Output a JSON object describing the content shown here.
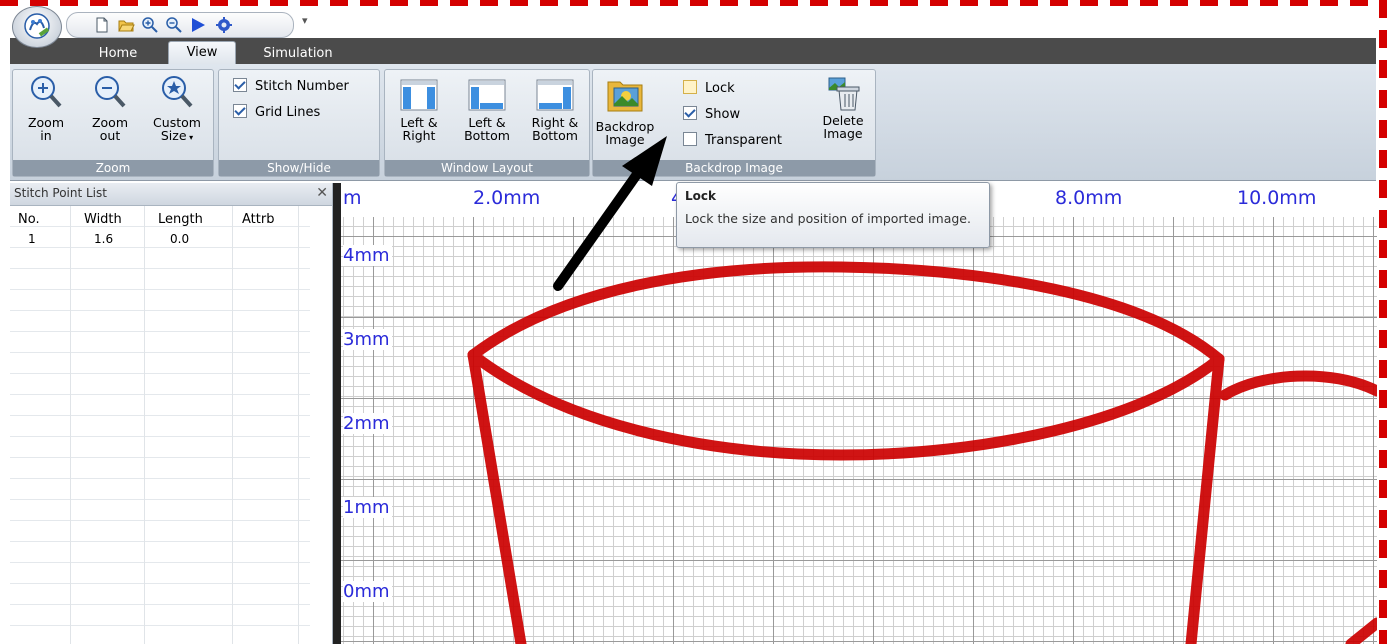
{
  "tabs": [
    "Home",
    "View",
    "Simulation"
  ],
  "active_tab": "View",
  "ribbon": {
    "zoom_group": {
      "label": "Zoom",
      "zoom_in": "Zoom\nin",
      "zoom_in_l1": "Zoom",
      "zoom_in_l2": "in",
      "zoom_out_l1": "Zoom",
      "zoom_out_l2": "out",
      "custom_l1": "Custom",
      "custom_l2": "Size"
    },
    "showhide_group": {
      "label": "Show/Hide",
      "stitch_number": "Stitch Number",
      "stitch_number_checked": true,
      "grid_lines": "Grid Lines",
      "grid_lines_checked": true
    },
    "layout_group": {
      "label": "Window Layout",
      "left_right_l1": "Left &",
      "left_right_l2": "Right",
      "left_bottom_l1": "Left &",
      "left_bottom_l2": "Bottom",
      "right_bottom_l1": "Right &",
      "right_bottom_l2": "Bottom"
    },
    "backdrop_group": {
      "label": "Backdrop Image",
      "backdrop_l1": "Backdrop",
      "backdrop_l2": "Image",
      "lock": "Lock",
      "lock_checked": false,
      "show": "Show",
      "show_checked": true,
      "transparent": "Transparent",
      "transparent_checked": false,
      "delete_l1": "Delete",
      "delete_l2": "Image"
    }
  },
  "panel": {
    "title": "Stitch Point List",
    "columns": [
      "No.",
      "Width",
      "Length",
      "Attrb"
    ],
    "rows": [
      {
        "no": "1",
        "width": "1.6",
        "length": "0.0",
        "attrb": ""
      }
    ]
  },
  "canvas": {
    "top_ruler": [
      "m",
      "2.0mm",
      "4",
      "8.0mm",
      "10.0mm"
    ],
    "left_ruler": [
      "4mm",
      "3mm",
      "2mm",
      "1mm",
      "0mm"
    ],
    "stitch_color": "#cc0000"
  },
  "tooltip": {
    "title": "Lock",
    "body": "Lock the size and position of imported image."
  },
  "colors": {
    "ruler_text": "#2b2bd9",
    "tab_bar": "#4b4b4b",
    "group_label_bg": "#8d9aa8",
    "annotation_border": "#d40000"
  }
}
